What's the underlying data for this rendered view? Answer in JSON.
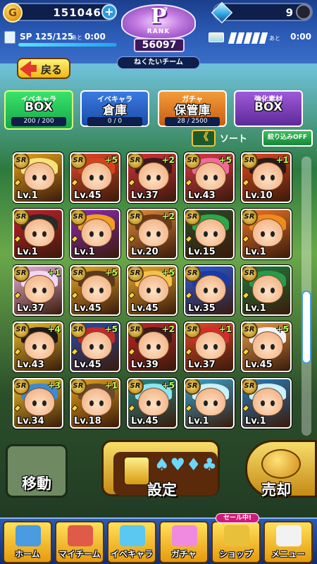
{
  "header": {
    "coins": "151046",
    "coin_icon_text": "G",
    "gems": "9",
    "sp": {
      "label": "SP 125/125",
      "ato": "あと",
      "time": "0:00",
      "fill": 1.0
    },
    "stamina": {
      "ato": "あと",
      "time": "0:00",
      "segments": 5
    },
    "rank": {
      "letter": "P",
      "sub": "7",
      "label": "RANK",
      "points": "56097"
    },
    "team_name": "ねくたいチーム"
  },
  "back_button": {
    "label": "戻る"
  },
  "tabs": [
    {
      "top": "イベキャラ",
      "main": "BOX",
      "count": "200 / 200"
    },
    {
      "top": "イベキャラ",
      "main": "倉庫",
      "count": "0 / 0"
    },
    {
      "top": "ガチャ",
      "main": "保管庫",
      "count": "28 / 2500"
    },
    {
      "top": "強化素材",
      "main": "BOX",
      "count": ""
    }
  ],
  "sort": {
    "chevron": "《",
    "label": "ソート",
    "filter_label": "絞り込みOFF"
  },
  "cards": [
    {
      "sr": "SR",
      "plus": "",
      "lv": "Lv.1",
      "bg": "#e6a11a",
      "hair": "#f7e27a"
    },
    {
      "sr": "SR",
      "plus": "+5",
      "lv": "Lv.45",
      "bg": "#e04a2a",
      "hair": "#d8421a"
    },
    {
      "sr": "SR",
      "plus": "+2",
      "lv": "Lv.37",
      "bg": "#d8323a",
      "hair": "#3a1a1a"
    },
    {
      "sr": "SR",
      "plus": "+5",
      "lv": "Lv.43",
      "bg": "#d83a4a",
      "hair": "#f26a9a"
    },
    {
      "sr": "SR",
      "plus": "+1",
      "lv": "Lv.10",
      "bg": "#e0481e",
      "hair": "#2a1a1a"
    },
    {
      "sr": "SR",
      "plus": "",
      "lv": "Lv.1",
      "bg": "#c2202a",
      "hair": "#2a2a2a"
    },
    {
      "sr": "SR",
      "plus": "",
      "lv": "Lv.1",
      "bg": "#8a2ab0",
      "hair": "#f2a020"
    },
    {
      "sr": "SR",
      "plus": "+2",
      "lv": "Lv.20",
      "bg": "#e08a3a",
      "hair": "#6a3a1a"
    },
    {
      "sr": "SR",
      "plus": "",
      "lv": "Lv.15",
      "bg": "#2a4a2a",
      "hair": "#2aa84a"
    },
    {
      "sr": "SR",
      "plus": "",
      "lv": "Lv.1",
      "bg": "#e8742a",
      "hair": "#f08a1a"
    },
    {
      "sr": "SR",
      "plus": "+1",
      "lv": "Lv.37",
      "bg": "#e6b0d8",
      "hair": "#f2d8f2"
    },
    {
      "sr": "SR",
      "plus": "+5",
      "lv": "Lv.45",
      "bg": "#e8a82a",
      "hair": "#5a3a1a"
    },
    {
      "sr": "SR",
      "plus": "+5",
      "lv": "Lv.45",
      "bg": "#e8a82a",
      "hair": "#f2c24a"
    },
    {
      "sr": "SR",
      "plus": "",
      "lv": "Lv.35",
      "bg": "#2a5ad8",
      "hair": "#1a3aa8"
    },
    {
      "sr": "SR",
      "plus": "",
      "lv": "Lv.1",
      "bg": "#1e7a3a",
      "hair": "#2a9a4a"
    },
    {
      "sr": "SR",
      "plus": "+4",
      "lv": "Lv.43",
      "bg": "#e8c02a",
      "hair": "#1a1a1a"
    },
    {
      "sr": "SR",
      "plus": "+5",
      "lv": "Lv.45",
      "bg": "#2a4aa8",
      "hair": "#c22a2a"
    },
    {
      "sr": "SR",
      "plus": "+2",
      "lv": "Lv.39",
      "bg": "#c2262a",
      "hair": "#3a1a1a"
    },
    {
      "sr": "SR",
      "plus": "+1",
      "lv": "Lv.37",
      "bg": "#e04a2a",
      "hair": "#d82a2a"
    },
    {
      "sr": "SR",
      "plus": "+5",
      "lv": "Lv.45",
      "bg": "#e89a4a",
      "hair": "#f2f2f2"
    },
    {
      "sr": "SR",
      "plus": "+3",
      "lv": "Lv.34",
      "bg": "#e8c02a",
      "hair": "#3a8ad8"
    },
    {
      "sr": "SR",
      "plus": "+1",
      "lv": "Lv.18",
      "bg": "#e6a11a",
      "hair": "#6a4a2a"
    },
    {
      "sr": "SR",
      "plus": "+5",
      "lv": "Lv.45",
      "bg": "#2a8a8a",
      "hair": "#8ae6f2"
    },
    {
      "sr": "SR",
      "plus": "",
      "lv": "Lv.1",
      "bg": "#3aa0c8",
      "hair": "#c8f2ff"
    },
    {
      "sr": "SR",
      "plus": "",
      "lv": "Lv.1",
      "bg": "#2a7ab8",
      "hair": "#c8f2ff"
    }
  ],
  "actions": {
    "move_label": "移動",
    "set_label": "設定",
    "set_suits": "♠♥♦♣",
    "sell_label": "売却"
  },
  "nav": [
    {
      "label": "ホーム",
      "icon": "home-icon"
    },
    {
      "label": "マイチーム",
      "icon": "team-icon"
    },
    {
      "label": "イベキャラ",
      "icon": "event-chara-icon"
    },
    {
      "label": "ガチャ",
      "icon": "gacha-icon"
    },
    {
      "label": "ショップ",
      "icon": "shop-icon"
    },
    {
      "label": "メニュー",
      "icon": "menu-icon"
    }
  ],
  "sale_badge": "セール中!",
  "colors": {
    "accent": "#f1b614",
    "nav_blue": "#2a5ab8",
    "green_tab": "#14a84a"
  }
}
